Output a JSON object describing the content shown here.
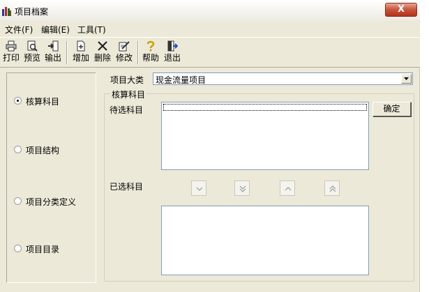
{
  "window": {
    "title": "项目档案",
    "close_glyph": "X"
  },
  "menu": [
    {
      "label": "文件(F)"
    },
    {
      "label": "编辑(E)"
    },
    {
      "label": "工具(T)"
    }
  ],
  "toolbar": {
    "print": "打印",
    "preview": "预览",
    "export": "输出",
    "add": "增加",
    "delete": "删除",
    "modify": "修改",
    "help": "帮助",
    "exit": "退出"
  },
  "left_panel": {
    "options": [
      {
        "label": "核算科目",
        "checked": true
      },
      {
        "label": "项目结构",
        "checked": false
      },
      {
        "label": "项目分类定义",
        "checked": false
      },
      {
        "label": "项目目录",
        "checked": false
      }
    ]
  },
  "main": {
    "category_label": "项目大类",
    "category_value": "现金流量项目",
    "group_title": "核算科目",
    "candidate_label": "待选科目",
    "selected_label": "已选科目",
    "confirm_button": "确定"
  }
}
